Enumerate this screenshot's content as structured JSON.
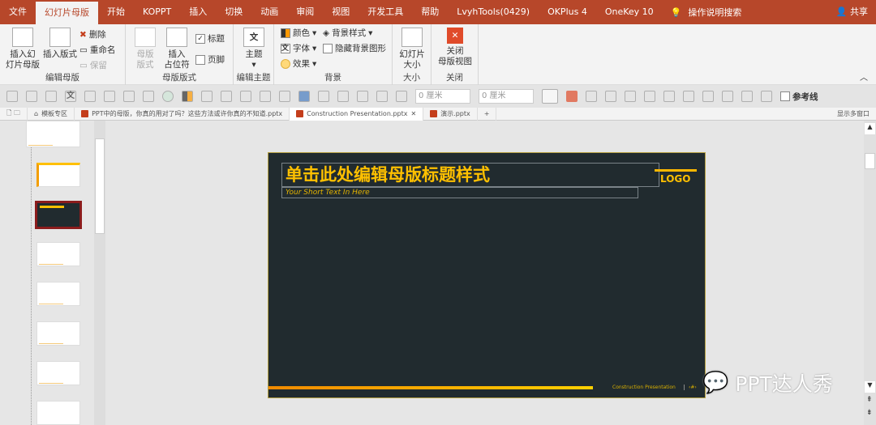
{
  "tabs": [
    "文件",
    "幻灯片母版",
    "开始",
    "KOPPT",
    "插入",
    "切换",
    "动画",
    "审阅",
    "视图",
    "开发工具",
    "帮助",
    "LvyhTools(0429)",
    "OKPlus 4",
    "OneKey 10"
  ],
  "search": "操作说明搜索",
  "share": "共享",
  "ribbon": {
    "edit_master": {
      "label": "编辑母版",
      "insert_master": "插入幻\n灯片母版",
      "insert_layout": "插入版式",
      "delete": "删除",
      "rename": "重命名",
      "preserve": "保留"
    },
    "master_layout": {
      "label": "母版版式",
      "master_layout_btn": "母版\n版式",
      "insert_placeholder": "插入\n占位符",
      "title": "标题",
      "footer": "页脚",
      "title_checked": true,
      "footer_checked": false
    },
    "edit_theme": {
      "label": "编辑主题",
      "theme": "主题"
    },
    "background": {
      "label": "背景",
      "colors": "颜色",
      "fonts": "字体",
      "effects": "效果",
      "bg_styles": "背景样式",
      "hide_bg": "隐藏背景图形"
    },
    "size": {
      "label": "大小",
      "slide_size": "幻灯片\n大小"
    },
    "close": {
      "label": "关闭",
      "close_master": "关闭\n母版视图"
    }
  },
  "toolbar": {
    "width": "0 厘米",
    "height": "0 厘米",
    "guides": "参考线"
  },
  "file_tabs": {
    "home": "模板专区",
    "tabs": [
      "PPT中的母版，你真的用对了吗？这些方法或许你真的不知道.pptx",
      "Construction Presentation.pptx",
      "演示.pptx"
    ],
    "multi_window": "显示多窗口"
  },
  "slide": {
    "title": "单击此处编辑母版标题样式",
    "subtitle": "Your Short Text In Here",
    "logo": "LOGO",
    "footer": "Construction Presentation",
    "page": "‹#›"
  },
  "watermark": "PPT达人秀",
  "colors": {
    "accent": "#b7472a",
    "slide_bg": "#212b2f",
    "gold": "#ffc000"
  }
}
